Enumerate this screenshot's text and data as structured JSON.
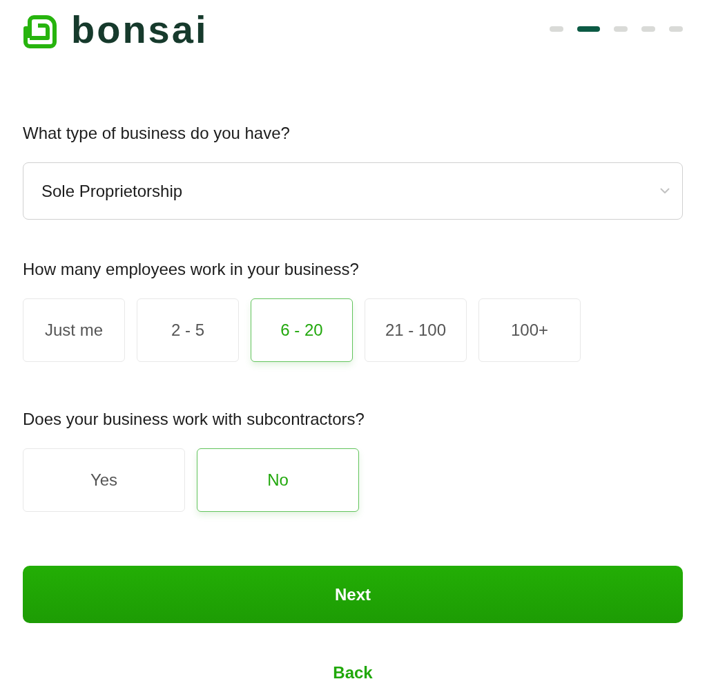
{
  "header": {
    "logo": {
      "text": "bonsai"
    },
    "progress_steps": [
      {
        "selected": false
      },
      {
        "selected": true
      },
      {
        "selected": false
      },
      {
        "selected": false
      },
      {
        "selected": false
      }
    ]
  },
  "questions": [
    {
      "kind": "select",
      "label": "What type of business do you have?",
      "value": "Sole Proprietorship"
    },
    {
      "kind": "choices",
      "label": "How many employees work in your business?",
      "options": [
        {
          "label": "Just me",
          "selected": false
        },
        {
          "label": "2 - 5",
          "selected": false
        },
        {
          "label": "6 - 20",
          "selected": true
        },
        {
          "label": "21 - 100",
          "selected": false
        },
        {
          "label": "100+",
          "selected": false
        }
      ]
    },
    {
      "kind": "choices",
      "label": "Does your business work with subcontractors?",
      "options": [
        {
          "label": "Yes",
          "selected": false
        },
        {
          "label": "No",
          "selected": true
        }
      ]
    }
  ],
  "actions": {
    "next": "Next",
    "back": "Back"
  }
}
